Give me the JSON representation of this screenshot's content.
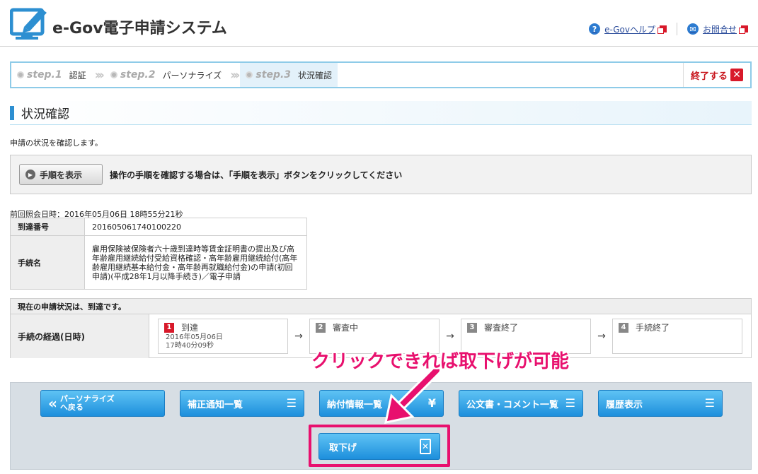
{
  "header": {
    "logo_text": "e-Gov電子申請システム",
    "links": [
      {
        "label": "e-Govヘルプ",
        "icon": "help-icon",
        "color": "#2d7bd0"
      },
      {
        "label": "お問合せ",
        "icon": "mail-icon",
        "color": "#2d7bd0"
      }
    ]
  },
  "steps": {
    "items": [
      {
        "num": "step.1",
        "label": "認証"
      },
      {
        "num": "step.2",
        "label": "パーソナライズ"
      },
      {
        "num": "step.3",
        "label": "状況確認"
      }
    ],
    "end_label": "終了する"
  },
  "page": {
    "title": "状況確認",
    "description": "申請の状況を確認します。",
    "howto_button": "手順を表示",
    "howto_text": "操作の手順を確認する場合は、「手順を表示」ボタンをクリックしてください",
    "last_ref": "前回照会日時：2016年05月06日 18時55分21秒"
  },
  "info_table": {
    "rows": [
      {
        "label": "到達番号",
        "value": "201605061740100220"
      },
      {
        "label": "手続名",
        "value": "雇用保険被保険者六十歳到達時等賃金証明書の提出及び高年齢雇用継続給付受給資格確認・高年齢雇用継続給付(高年齢雇用継続基本給付金・高年齢再就職給付金)の申請(初回申請)(平成28年1月以降手続き)／電子申請"
      }
    ]
  },
  "status": {
    "heading": "現在の申請状況は、到達です。",
    "label": "手続の経過(日時)",
    "flow": [
      {
        "n": "1",
        "title": "到達",
        "date": "2016年05月06日",
        "time": "17時40分09秒"
      },
      {
        "n": "2",
        "title": "審査中"
      },
      {
        "n": "3",
        "title": "審査終了"
      },
      {
        "n": "4",
        "title": "手続終了"
      }
    ]
  },
  "actions": {
    "back_line1": "パーソナライズ",
    "back_line2": "へ戻る",
    "correction": "補正通知一覧",
    "payment": "納付情報一覧",
    "payment_icon": "¥",
    "documents": "公文書・コメント一覧",
    "history": "履歴表示",
    "withdraw": "取下げ"
  },
  "annotation": {
    "text": "クリックできれば取下げが可能",
    "color": "#e8106e"
  },
  "colors": {
    "accent": "#2d8fd1",
    "button": "#1d8fdc",
    "danger": "#d8192a"
  }
}
